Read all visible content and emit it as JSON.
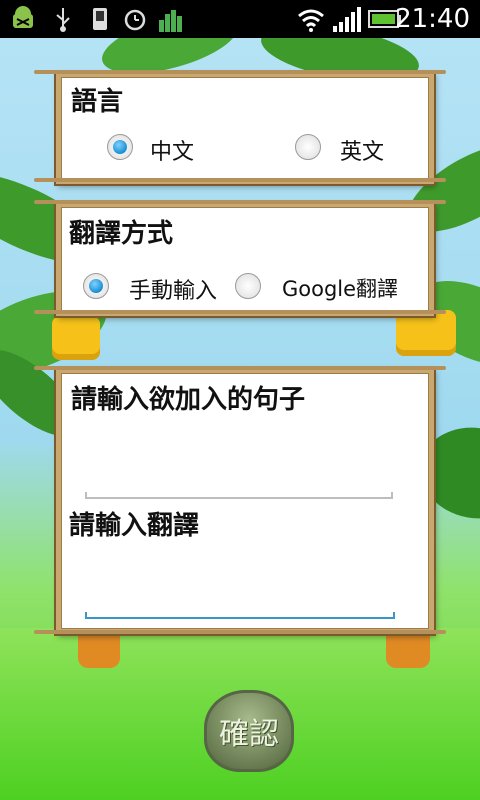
{
  "status_bar": {
    "time": "21:40",
    "left_icons": [
      "android-debug-icon",
      "usb-icon",
      "phone-sd-icon",
      "alarm-icon",
      "signal-meter-icon"
    ],
    "right_icons": [
      "wifi-icon",
      "cell-signal-icon",
      "battery-icon"
    ]
  },
  "language_panel": {
    "title": "語言",
    "options": [
      {
        "label": "中文",
        "checked": true
      },
      {
        "label": "英文",
        "checked": false
      }
    ]
  },
  "translate_panel": {
    "title": "翻譯方式",
    "options": [
      {
        "label": "手動輸入",
        "checked": true
      },
      {
        "label": "Google翻譯",
        "checked": false
      }
    ]
  },
  "input_panel": {
    "sentence_label": "請輸入欲加入的句子",
    "translation_label": "請輸入翻譯",
    "sentence_value": "",
    "translation_value": ""
  },
  "confirm_button": {
    "label": "確認"
  },
  "colors": {
    "radio_checked": "#1a8fd3",
    "focus_line": "#3a96c9",
    "frame": "#c8a870"
  }
}
